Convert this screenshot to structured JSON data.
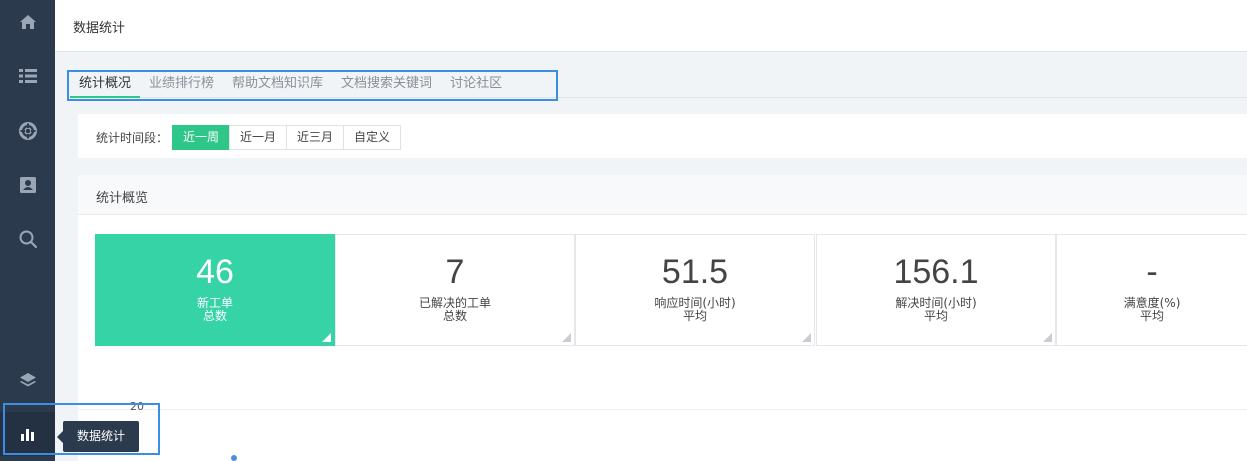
{
  "breadcrumb": "数据统计",
  "tabs": [
    {
      "label": "统计概况",
      "active": true
    },
    {
      "label": "业绩排行榜",
      "active": false
    },
    {
      "label": "帮助文档知识库",
      "active": false
    },
    {
      "label": "文档搜索关键词",
      "active": false
    },
    {
      "label": "讨论社区",
      "active": false
    }
  ],
  "time_filter": {
    "label": "统计时间段：",
    "options": [
      "近一周",
      "近一月",
      "近三月",
      "自定义"
    ],
    "selected": "近一周"
  },
  "overview": {
    "title": "统计概览",
    "stats": [
      {
        "value": "46",
        "label1": "新工单",
        "label2": "总数"
      },
      {
        "value": "7",
        "label1": "已解决的工单",
        "label2": "总数"
      },
      {
        "value": "51.5",
        "label1": "响应时间(小时)",
        "label2": "平均"
      },
      {
        "value": "156.1",
        "label1": "解决时间(小时)",
        "label2": "平均"
      },
      {
        "value": "-",
        "label1": "满意度(%)",
        "label2": "平均"
      }
    ],
    "chart_y_tick": "20"
  },
  "sidebar": {
    "items": [
      "home-icon",
      "list-icon",
      "support-icon",
      "contact-icon",
      "search-icon",
      "layers-icon",
      "bar-chart-icon"
    ],
    "tooltip": "数据统计"
  },
  "colors": {
    "accent": "#2ec789",
    "stat_active": "#36d3a7",
    "sidebar": "#2c3a4e",
    "highlight": "#3b8fe2"
  }
}
